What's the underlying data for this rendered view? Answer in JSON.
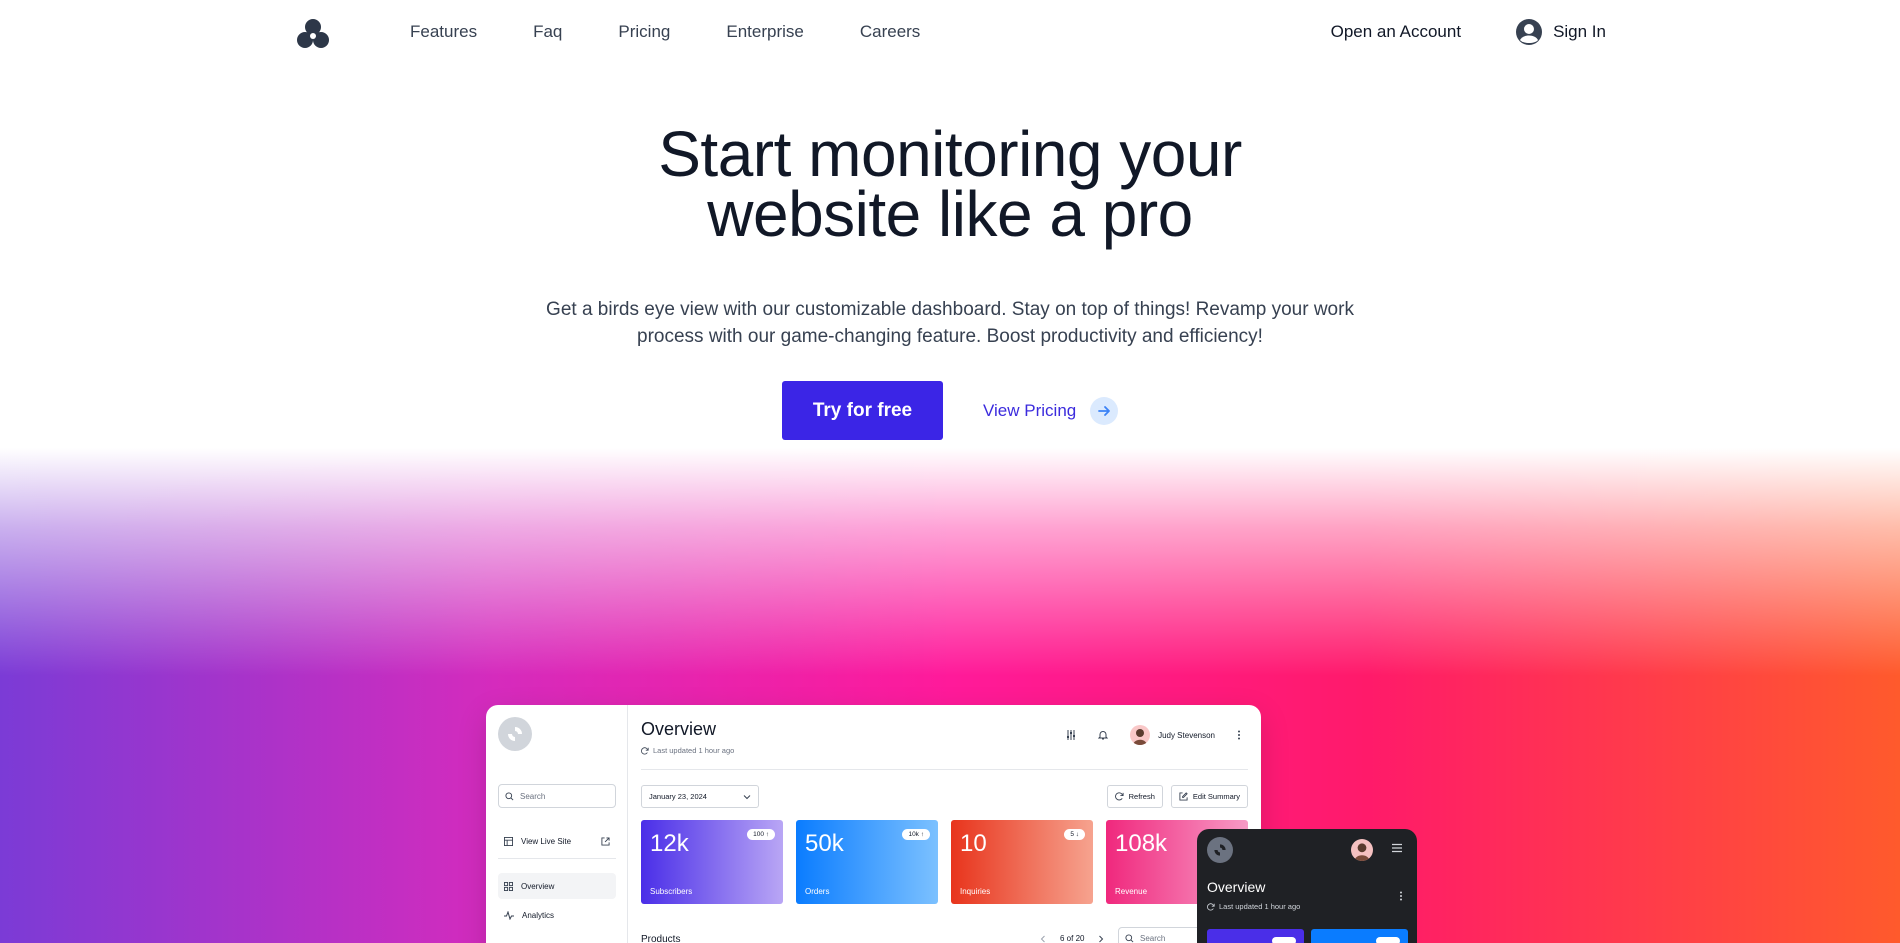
{
  "nav": {
    "links": [
      "Features",
      "Faq",
      "Pricing",
      "Enterprise",
      "Careers"
    ],
    "open_account": "Open an Account",
    "sign_in": "Sign In"
  },
  "hero": {
    "title_line1": "Start monitoring your",
    "title_line2": "website like a pro",
    "subtitle": "Get a birds eye view with our customizable dashboard. Stay on top of things! Revamp your work process with our game-changing feature. Boost productivity and efficiency!",
    "cta_primary": "Try for free",
    "cta_secondary": "View Pricing"
  },
  "colors": {
    "primary": "#3b25e6",
    "link": "#3b2bdd",
    "gradient_left": "#7b3bd6",
    "gradient_mid": "#ff1a9a",
    "gradient_right": "#ff5a2c"
  },
  "dashboard": {
    "sidebar": {
      "search_placeholder": "Search",
      "view_live_site": "View Live Site",
      "items": [
        "Overview",
        "Analytics"
      ]
    },
    "title": "Overview",
    "last_updated": "Last updated 1 hour ago",
    "user_name": "Judy Stevenson",
    "date": "January 23, 2024",
    "refresh": "Refresh",
    "edit_summary": "Edit Summary",
    "cards": [
      {
        "value": "12k",
        "label": "Subscribers",
        "badge": "100 ↑"
      },
      {
        "value": "50k",
        "label": "Orders",
        "badge": "10k ↑"
      },
      {
        "value": "10",
        "label": "Inquiries",
        "badge": "5 ↓"
      },
      {
        "value": "108k",
        "label": "Revenue",
        "badge": ""
      }
    ],
    "products_label": "Products",
    "pager": "6 of 20",
    "products_search_placeholder": "Search"
  },
  "mobile": {
    "title": "Overview",
    "last_updated": "Last updated 1 hour ago"
  }
}
